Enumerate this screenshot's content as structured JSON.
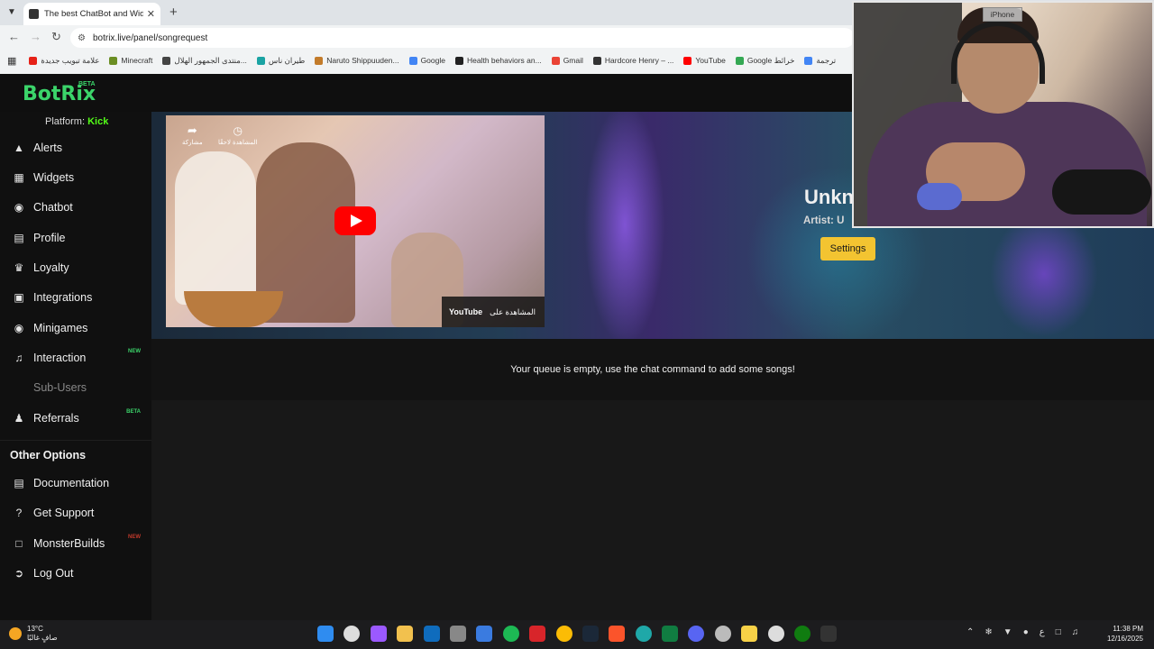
{
  "browser": {
    "tab_title": "The best ChatBot and Widgets",
    "new_tab_label": "+",
    "url": "botrix.live/panel/songrequest",
    "bookmarks": [
      {
        "label": "علامة تبويب جديدة",
        "color": "#e62117"
      },
      {
        "label": "Minecraft",
        "color": "#6b8e23"
      },
      {
        "label": "منتدى الجمهور الهلال...",
        "color": "#444444"
      },
      {
        "label": "طيران ناس",
        "color": "#1aa3a3"
      },
      {
        "label": "Naruto Shippuuden...",
        "color": "#c27b2a"
      },
      {
        "label": "Google",
        "color": "#4285f4"
      },
      {
        "label": "Health behaviors an...",
        "color": "#222222"
      },
      {
        "label": "Gmail",
        "color": "#ea4335"
      },
      {
        "label": "Hardcore Henry – ...",
        "color": "#333333"
      },
      {
        "label": "YouTube",
        "color": "#ff0000"
      },
      {
        "label": "Google خرائط",
        "color": "#34a853"
      },
      {
        "label": "ترجمة",
        "color": "#4285f4"
      }
    ]
  },
  "app": {
    "logo": "BotRix",
    "logo_badge": "BETA",
    "accent_color": "#3bd46a"
  },
  "sidebar": {
    "platform_label": "Platform:",
    "platform_value": "Kick",
    "items": [
      {
        "label": "Alerts",
        "icon": "warning-icon"
      },
      {
        "label": "Widgets",
        "icon": "grid-icon"
      },
      {
        "label": "Chatbot",
        "icon": "robot-icon"
      },
      {
        "label": "Profile",
        "icon": "id-card-icon"
      },
      {
        "label": "Loyalty",
        "icon": "trophy-icon"
      },
      {
        "label": "Integrations",
        "icon": "integration-icon"
      },
      {
        "label": "Minigames",
        "icon": "gamepad-icon"
      },
      {
        "label": "Interaction",
        "icon": "music-icon",
        "tag": "NEW"
      },
      {
        "label": "Sub-Users",
        "icon": "sub-users-icon"
      },
      {
        "label": "Referrals",
        "icon": "users-icon",
        "tag": "BETA"
      }
    ],
    "other_title": "Other Options",
    "other_items": [
      {
        "label": "Documentation",
        "icon": "book-icon"
      },
      {
        "label": "Get Support",
        "icon": "question-icon"
      },
      {
        "label": "MonsterBuilds",
        "icon": "laptop-icon",
        "tag": "NEW"
      },
      {
        "label": "Log Out",
        "icon": "logout-icon"
      }
    ]
  },
  "player": {
    "share_label": "مشاركة",
    "watch_later_label": "المشاهدة لاحقًا",
    "watch_on_label": "المشاهدة على",
    "youtube_label": "YouTube",
    "song_title": "Unkn",
    "artist_label": "Artist:",
    "artist_value": "U",
    "settings_label": "Settings"
  },
  "queue": {
    "empty_message": "Your queue is empty, use the chat command to add some songs!"
  },
  "webcam": {
    "device_label": "iPhone"
  },
  "taskbar": {
    "temperature": "13°C",
    "weather_text": "صافٍ غالبًا",
    "tray_lang": "ع",
    "time": "11:38 PM",
    "date": "12/16/2025",
    "app_icons": [
      {
        "name": "start-icon",
        "color": "#2f8cf0"
      },
      {
        "name": "search-icon",
        "color": "#dddddd"
      },
      {
        "name": "copilot-icon",
        "color": "#9b59ff"
      },
      {
        "name": "file-explorer-icon",
        "color": "#f2c14e"
      },
      {
        "name": "outlook-icon",
        "color": "#0f6cbd"
      },
      {
        "name": "settings-icon",
        "color": "#888888"
      },
      {
        "name": "store-icon",
        "color": "#3a7be0"
      },
      {
        "name": "spotify-icon",
        "color": "#1db954"
      },
      {
        "name": "app-red-icon",
        "color": "#d8252a"
      },
      {
        "name": "chrome-icon",
        "color": "#fbbc05"
      },
      {
        "name": "steam-icon",
        "color": "#1b2838"
      },
      {
        "name": "brave-icon",
        "color": "#fb542b"
      },
      {
        "name": "edge-icon",
        "color": "#1fa8a8"
      },
      {
        "name": "excel-icon",
        "color": "#107c41"
      },
      {
        "name": "discord-icon",
        "color": "#5865f2"
      },
      {
        "name": "clock-app-icon",
        "color": "#bbbbbb"
      },
      {
        "name": "sticky-notes-icon",
        "color": "#f7d147"
      },
      {
        "name": "camera-icon",
        "color": "#dddddd"
      },
      {
        "name": "xbox-icon",
        "color": "#107c10"
      },
      {
        "name": "obs-icon",
        "color": "#333333"
      }
    ]
  }
}
